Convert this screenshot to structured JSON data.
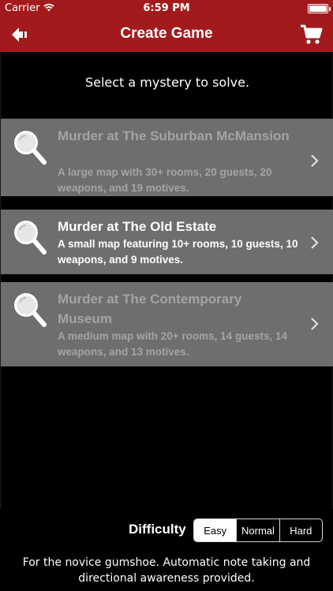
{
  "status_bar": {
    "carrier": "Carrier",
    "time": "6:59 PM"
  },
  "nav": {
    "title": "Create Game",
    "back_icon": "back-arrow-icon",
    "cart_icon": "cart-icon"
  },
  "prompt": "Select a mystery to solve.",
  "mysteries": [
    {
      "title": "Murder at The Suburban McMansion",
      "description": "A large map with 30+ rooms, 20 guests, 20 weapons, and 19 motives.",
      "state": "dim"
    },
    {
      "title": "Murder at The Old Estate",
      "description": "A small map featuring 10+ rooms, 10 guests, 10 weapons, and 9 motives.",
      "state": "active"
    },
    {
      "title": "Murder at The Contemporary Museum",
      "description": "A medium map with 20+ rooms, 14 guests, 14 weapons, and 13 motives.",
      "state": "dim"
    }
  ],
  "difficulty": {
    "label": "Difficulty",
    "options": [
      "Easy",
      "Normal",
      "Hard"
    ],
    "selected": "Easy",
    "note": "For the novice gumshoe. Automatic note taking and directional awareness provided."
  },
  "colors": {
    "accent": "#a31a1d",
    "row_bg": "#6e6e6e",
    "dim_text": "#a4a4a4"
  }
}
